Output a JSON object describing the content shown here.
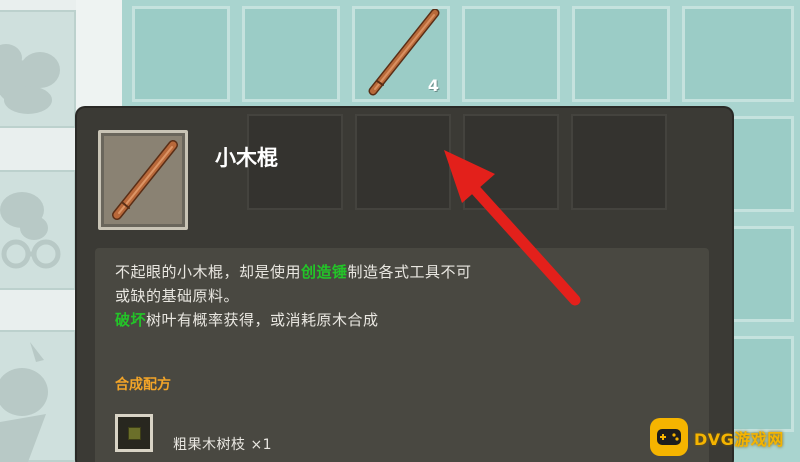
{
  "inventory": {
    "slot_count_label": "4",
    "held_item_icon": "wooden-stick-icon"
  },
  "tooltip": {
    "item_name": "小木棍",
    "item_icon": "wooden-stick-icon",
    "desc": {
      "part1": "不起眼的小木棍，却是使用",
      "highlight1": "创造锤",
      "part2": "制造各式工具不可",
      "line2": "或缺的基础原料。",
      "highlight2": "破坏",
      "part3": "树叶有概率获得，或消耗原木合成"
    },
    "recipe_title": "合成配方",
    "ingredients": [
      {
        "label": "粗果木树枝 ×1",
        "icon": "branch-block-icon"
      }
    ]
  },
  "watermark": {
    "text": "DVG游戏网",
    "icon": "gamepad-icon"
  },
  "colors": {
    "highlight_green": "#23c428",
    "recipe_orange": "#f2a428",
    "arrow_red": "#e3201b",
    "inventory_teal": "#a9d4cf"
  }
}
